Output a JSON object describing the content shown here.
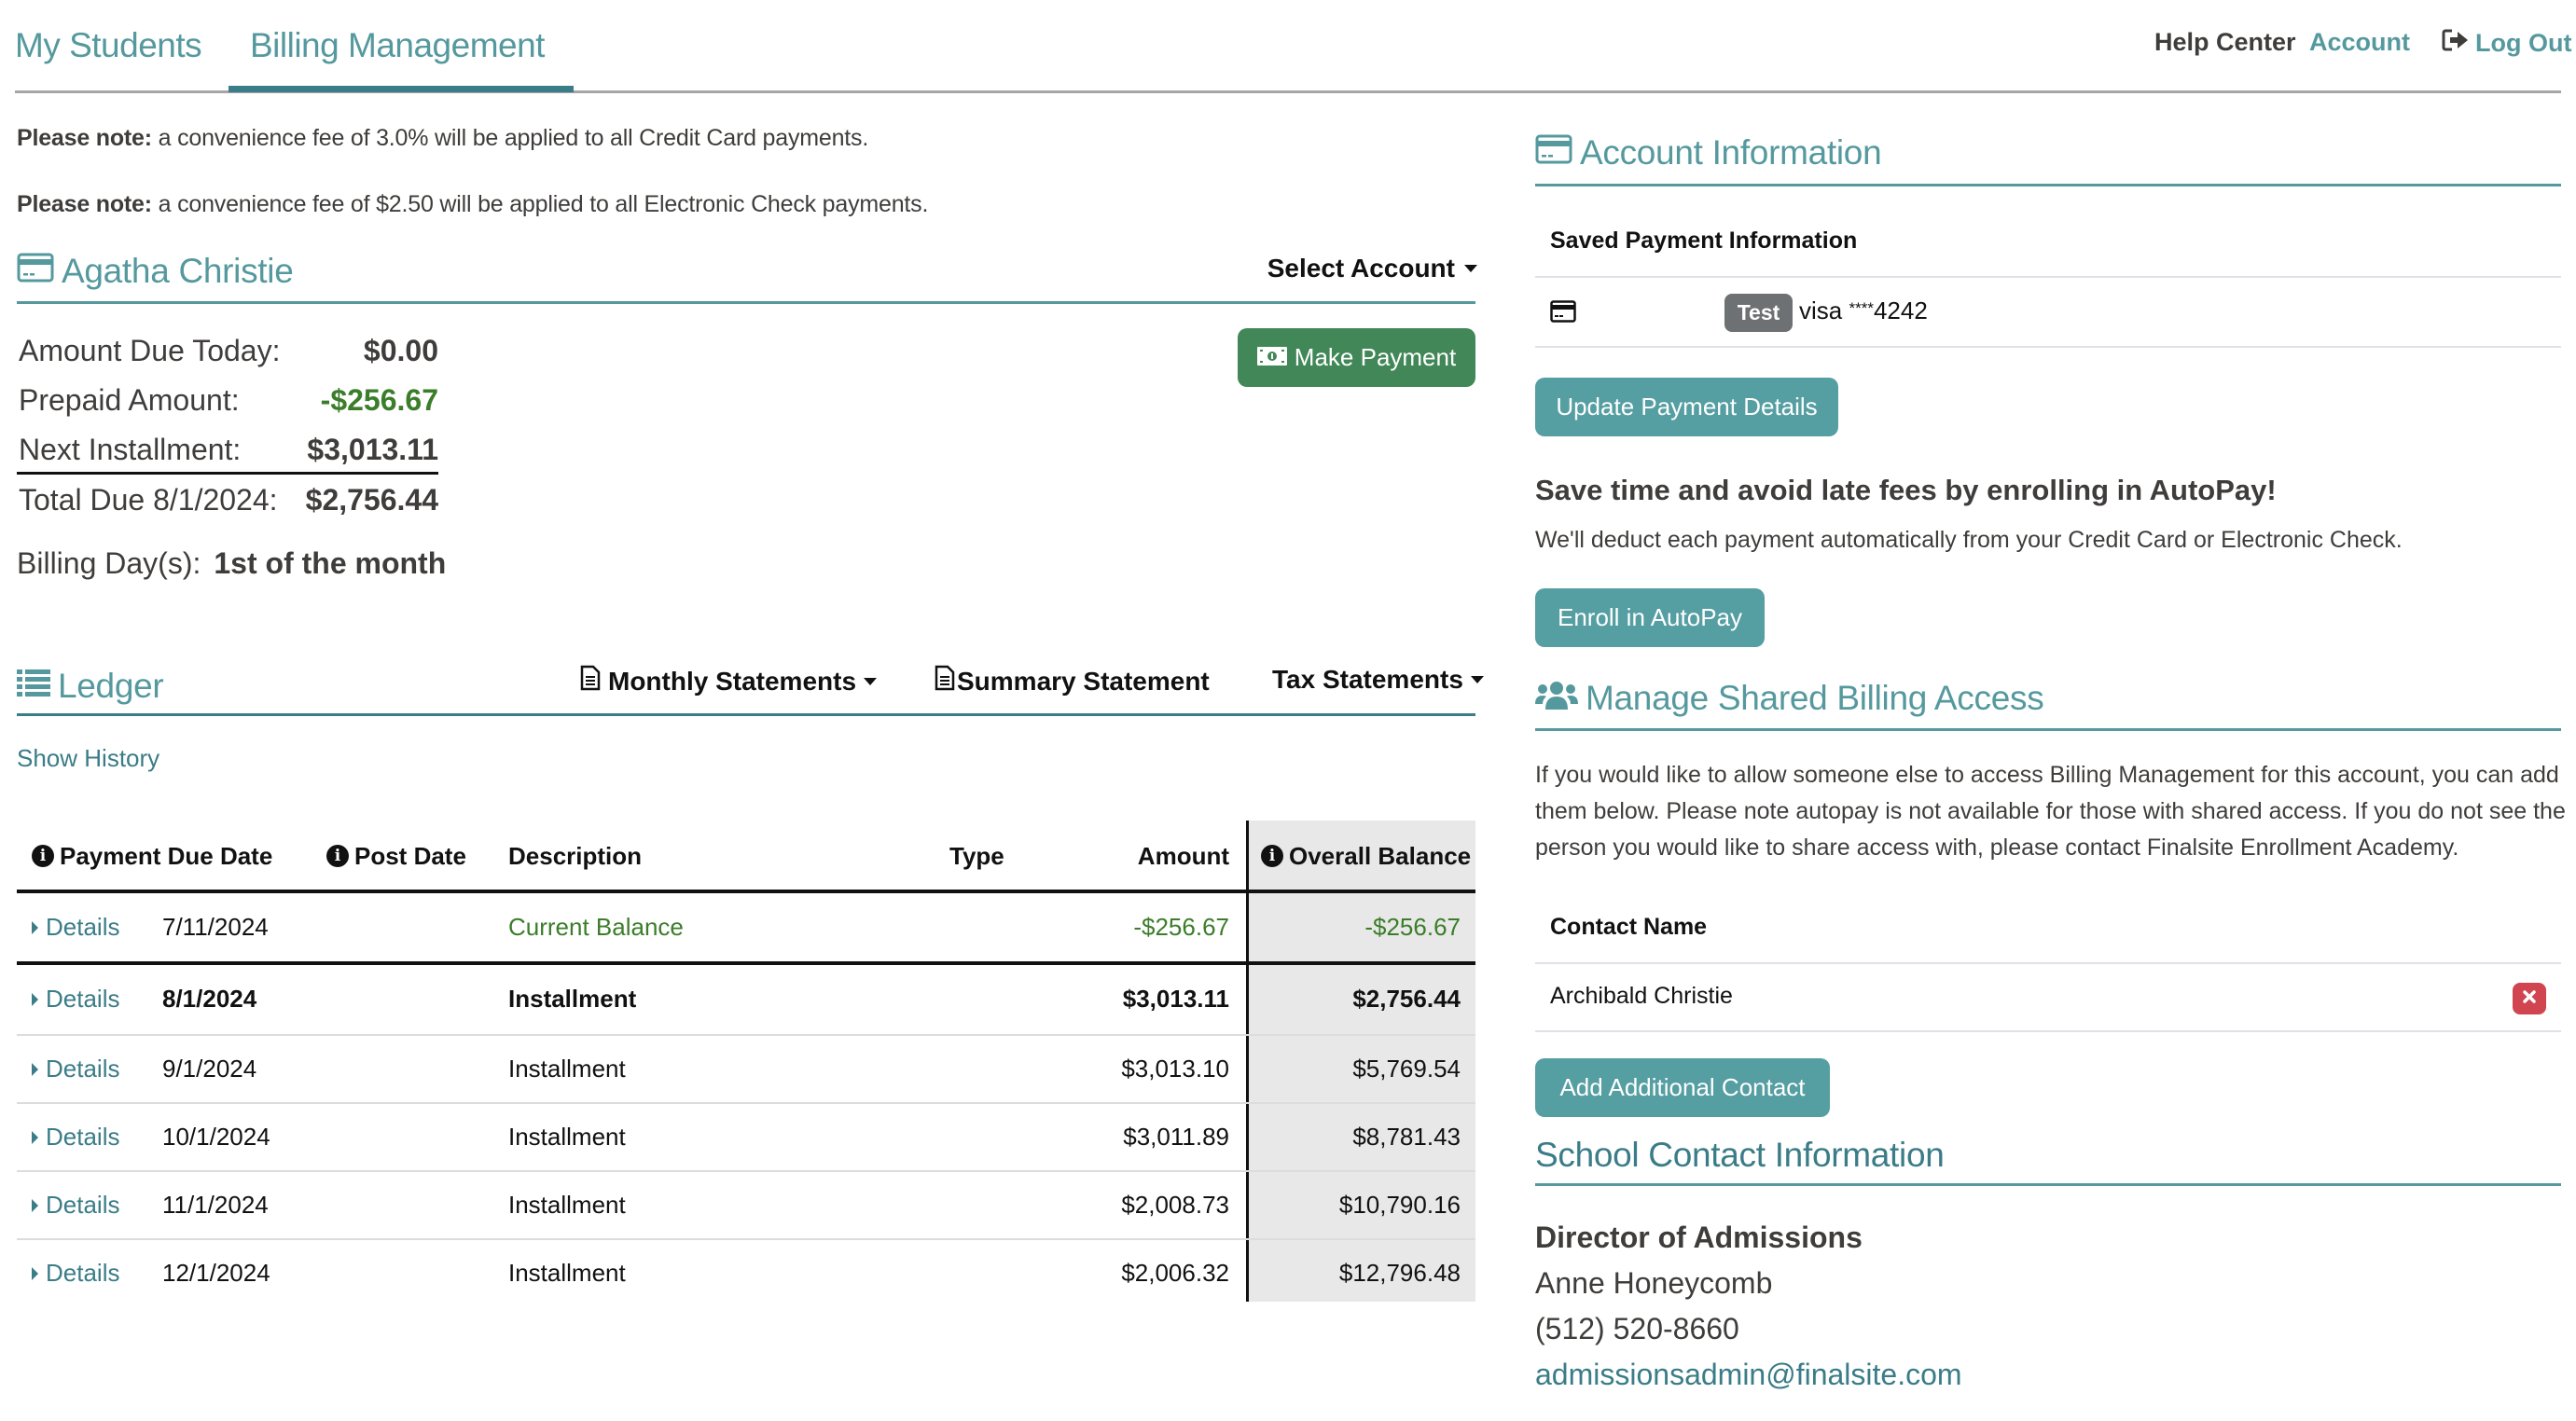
{
  "nav": {
    "tabs": [
      {
        "label": "My Students",
        "active": false
      },
      {
        "label": "Billing Management",
        "active": true
      }
    ],
    "help_center": "Help Center",
    "account": "Account",
    "log_out": "Log Out"
  },
  "notes": [
    {
      "prefix": "Please note:",
      "text": " a convenience fee of 3.0% will be applied to all Credit Card payments."
    },
    {
      "prefix": "Please note:",
      "text": " a convenience fee of $2.50 will be applied to all Electronic Check payments."
    }
  ],
  "account_summary": {
    "name": "Agatha Christie",
    "select_account": "Select Account",
    "make_payment": "Make Payment",
    "rows": [
      {
        "label": "Amount Due Today:",
        "value": "$0.00"
      },
      {
        "label": "Prepaid Amount:",
        "value": "-$256.67"
      },
      {
        "label": "Next Installment:",
        "value": "$3,013.11"
      },
      {
        "label": "Total Due 8/1/2024:",
        "value": "$2,756.44"
      }
    ],
    "billing_day_label": "Billing Day(s):",
    "billing_day_value": "1st of the month"
  },
  "ledger": {
    "title": "Ledger",
    "monthly_statements": "Monthly Statements",
    "summary_statement": "Summary Statement",
    "tax_statements": "Tax Statements",
    "show_history": "Show History",
    "columns": [
      "Payment Due Date",
      "Post Date",
      "Description",
      "Type",
      "Amount",
      "Overall Balance"
    ],
    "details_label": "Details",
    "rows": [
      {
        "due_date": "7/11/2024",
        "post_date": "",
        "description": "Current Balance",
        "type": "",
        "amount": "-$256.67",
        "balance": "-$256.67"
      },
      {
        "due_date": "8/1/2024",
        "post_date": "",
        "description": "Installment",
        "type": "",
        "amount": "$3,013.11",
        "balance": "$2,756.44"
      },
      {
        "due_date": "9/1/2024",
        "post_date": "",
        "description": "Installment",
        "type": "",
        "amount": "$3,013.10",
        "balance": "$5,769.54"
      },
      {
        "due_date": "10/1/2024",
        "post_date": "",
        "description": "Installment",
        "type": "",
        "amount": "$3,011.89",
        "balance": "$8,781.43"
      },
      {
        "due_date": "11/1/2024",
        "post_date": "",
        "description": "Installment",
        "type": "",
        "amount": "$2,008.73",
        "balance": "$10,790.16"
      },
      {
        "due_date": "12/1/2024",
        "post_date": "",
        "description": "Installment",
        "type": "",
        "amount": "$2,006.32",
        "balance": "$12,796.48"
      }
    ]
  },
  "account_info": {
    "title": "Account Information",
    "saved_payment_header": "Saved Payment Information",
    "badge": "Test",
    "card_brand": "visa",
    "card_mask": "****",
    "card_last4": "4242",
    "update_button": "Update Payment Details",
    "autopay_heading": "Save time and avoid late fees by enrolling in AutoPay!",
    "autopay_text": "We'll deduct each payment automatically from your Credit Card or Electronic Check.",
    "enroll_button": "Enroll in AutoPay"
  },
  "shared_access": {
    "title": "Manage Shared Billing Access",
    "description": "If you would like to allow someone else to access Billing Management for this account, you can add them below. Please note autopay is not available for those with shared access. If you do not see the person you would like to share access with, please contact Finalsite Enrollment Academy.",
    "contact_header": "Contact Name",
    "contacts": [
      "Archibald Christie"
    ],
    "add_button": "Add Additional Contact"
  },
  "school_contact": {
    "title": "School Contact Information",
    "role": "Director of Admissions",
    "name": "Anne Honeycomb",
    "phone": "(512) 520-8660",
    "email": "admissionsadmin@finalsite.com"
  },
  "colors": {
    "teal": "#55999e",
    "teal_dark": "#3a7c87",
    "green_button": "#418758",
    "positive_green": "#3b7d2a",
    "delete_red": "#d04550",
    "balance_column_bg": "#e8e8e8"
  }
}
